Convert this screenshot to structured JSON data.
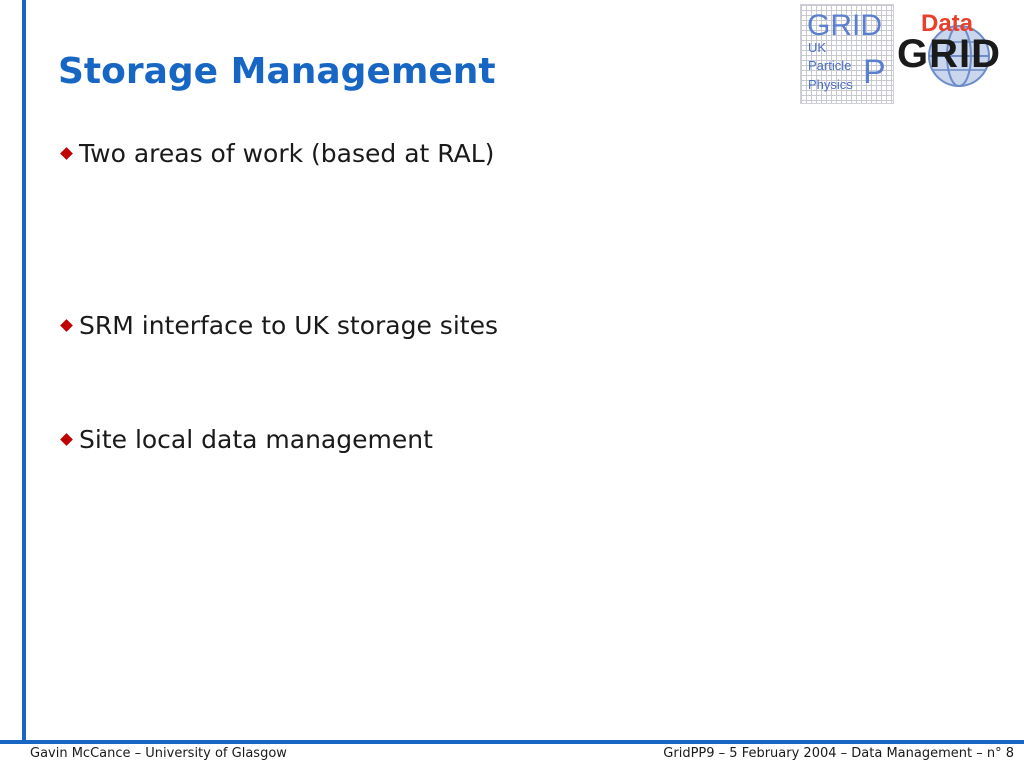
{
  "colors": {
    "accent": "#1766c4",
    "bullet": "#c00000",
    "text": "#1a1a1a",
    "gridpp_blue": "#5a7fd0",
    "datagrid_red": "#e8402a"
  },
  "title": "Storage Management",
  "bullets": [
    {
      "icon": "diamond-bullet-icon",
      "text": "Two areas of work (based at RAL)"
    },
    {
      "icon": "diamond-bullet-icon",
      "text": "SRM interface to UK storage sites"
    },
    {
      "icon": "diamond-bullet-icon",
      "text": "Site local data management"
    }
  ],
  "logos": {
    "gridpp": {
      "grid": "GRID",
      "p": "P",
      "uk": "UK",
      "particle": "Particle",
      "physics": "Physics"
    },
    "datagrid": {
      "data": "Data",
      "grid": "GRID"
    }
  },
  "footer": {
    "left": "Gavin McCance – University of Glasgow",
    "right": "GridPP9 – 5 February 2004 – Data Management  –  n° 8"
  }
}
